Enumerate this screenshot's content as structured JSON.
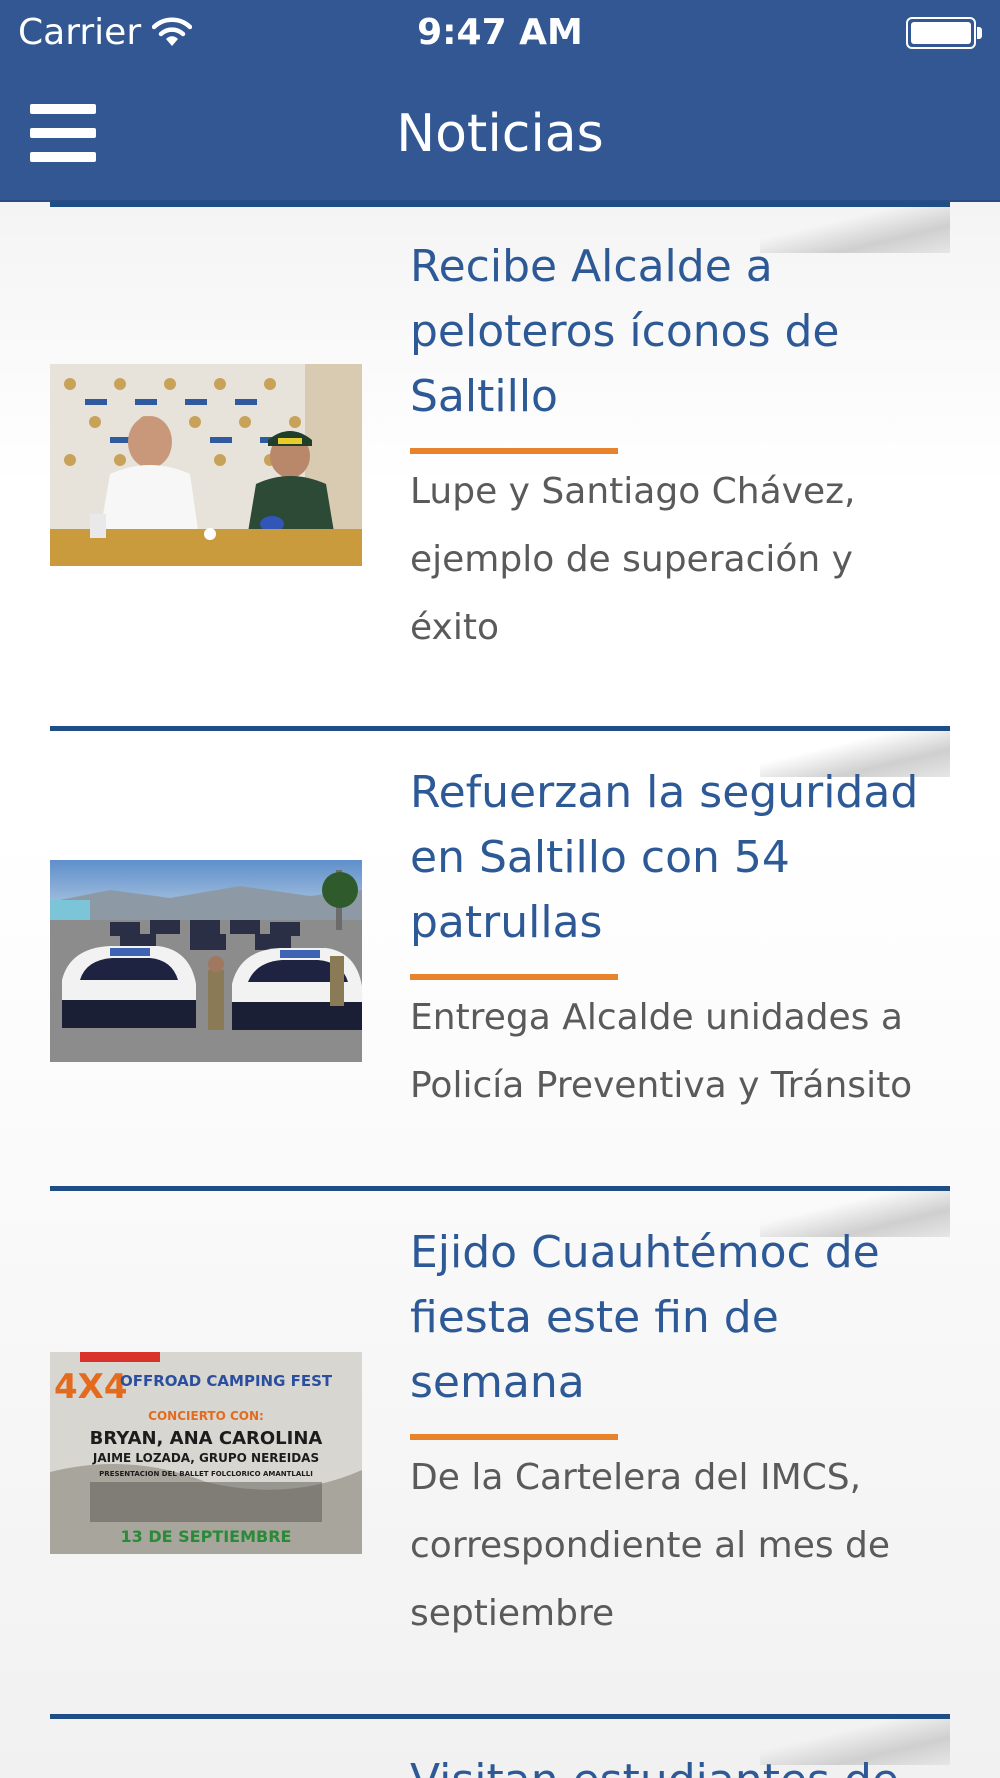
{
  "status_bar": {
    "carrier": "Carrier",
    "time": "9:47 AM",
    "wifi_icon": "wifi-icon",
    "battery_icon": "battery-icon"
  },
  "nav": {
    "title": "Noticias",
    "menu_icon": "hamburger-menu-icon"
  },
  "colors": {
    "brand_blue": "#325792",
    "title_blue": "#2d5a96",
    "rule_blue": "#1f4e86",
    "accent_orange": "#e8822c",
    "summary_gray": "#5a5a5a"
  },
  "articles": [
    {
      "title": "Recibe Alcalde a peloteros íconos de Saltillo",
      "summary": "Lupe y Santiago Chávez, ejemplo de superación y éxito"
    },
    {
      "title": "Refuerzan la seguridad en Saltillo con 54 patrullas",
      "summary": "Entrega Alcalde unidades a Policía Preventiva y Tránsito"
    },
    {
      "title": "Ejido Cuauhtémoc de fiesta este fin de semana",
      "summary": "De la Cartelera del IMCS, correspondiente al mes de septiembre",
      "poster": {
        "tag": "4X4",
        "headline": "OFFROAD CAMPING FEST",
        "concert_label": "CONCIERTO CON:",
        "artists_line1": "BRYAN, ANA CAROLINA",
        "artists_line2": "JAIME LOZADA, GRUPO NEREIDAS",
        "artists_line3": "PRESENTACION DEL BALLET FOLCLORICO AMANTLALLI",
        "date": "13 DE SEPTIEMBRE"
      }
    },
    {
      "title": "Visitan estudiantes de",
      "summary": ""
    }
  ]
}
